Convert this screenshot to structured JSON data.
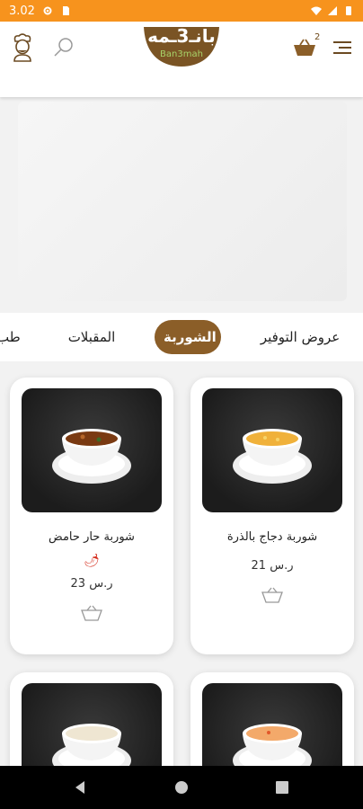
{
  "status_bar": {
    "time": "3.02"
  },
  "header": {
    "logo_text": "بانـ3ـمه",
    "logo_subtext": "Ban3mah",
    "cart_count": "2",
    "icons": [
      "menu-icon",
      "cart-icon",
      "search-icon",
      "chef-icon"
    ]
  },
  "categories": [
    {
      "label": "عروض التوفير",
      "active": false
    },
    {
      "label": "الشوربة",
      "active": true
    },
    {
      "label": "المقبلات",
      "active": false
    },
    {
      "label": "اطب",
      "active": false
    }
  ],
  "products": [
    {
      "name": "شوربة دجاج بالذرة",
      "price": "21 ر.س",
      "spicy": false
    },
    {
      "name": "شوربة حار حامض",
      "price": "23 ر.س",
      "spicy": true
    },
    {
      "name": "",
      "price": "",
      "spicy": false
    },
    {
      "name": "",
      "price": "",
      "spicy": false
    }
  ],
  "colors": {
    "accent": "#f7931d",
    "brand_brown": "#8b5e28",
    "spicy_red": "#d42a1a"
  }
}
